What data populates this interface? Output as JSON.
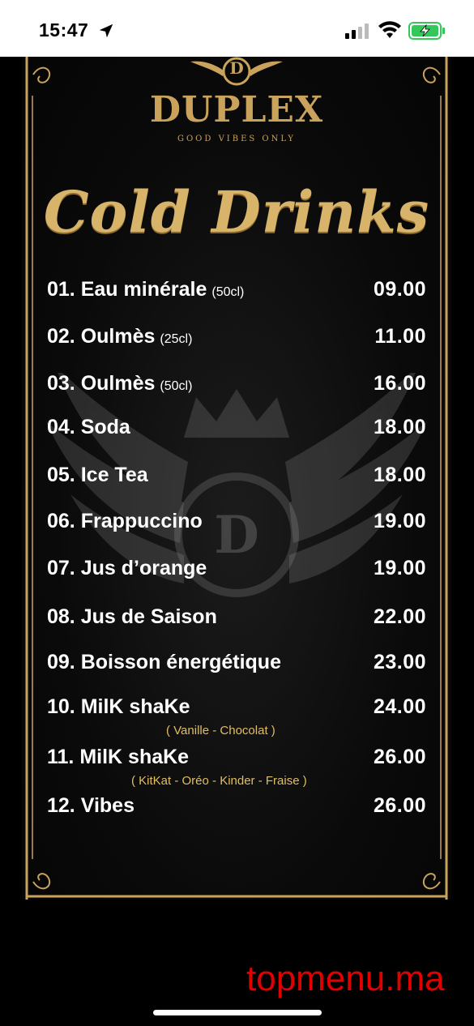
{
  "status_bar": {
    "time": "15:47",
    "icons": [
      "location-arrow-icon",
      "cellular-signal-icon",
      "wifi-icon",
      "battery-charging-icon"
    ],
    "battery_color": "#34c759"
  },
  "menu": {
    "brand": "DUPLEX",
    "brand_monogram": "D",
    "tagline": "GOOD  VIBES ONLY",
    "title": "Cold Drinks",
    "accent_color": "#c9a35b",
    "items": [
      {
        "number": "01.",
        "name": "Eau minérale",
        "size": "(50cl)",
        "price": "09.00",
        "note": ""
      },
      {
        "number": "02.",
        "name": "Oulmès",
        "size": "(25cl)",
        "price": "11.00",
        "note": ""
      },
      {
        "number": "03.",
        "name": "Oulmès",
        "size": "(50cl)",
        "price": "16.00",
        "note": ""
      },
      {
        "number": "04.",
        "name": "Soda",
        "size": "",
        "price": "18.00",
        "note": ""
      },
      {
        "number": "05.",
        "name": "Ice Tea",
        "size": "",
        "price": "18.00",
        "note": ""
      },
      {
        "number": "06.",
        "name": "Frappuccino",
        "size": "",
        "price": "19.00",
        "note": ""
      },
      {
        "number": "07.",
        "name": "Jus d’orange",
        "size": "",
        "price": "19.00",
        "note": ""
      },
      {
        "number": "08.",
        "name": "Jus de Saison",
        "size": "",
        "price": "22.00",
        "note": ""
      },
      {
        "number": "09.",
        "name": "Boisson énergétique",
        "size": "",
        "price": "23.00",
        "note": ""
      },
      {
        "number": "10.",
        "name": "MilK shaKe",
        "size": "",
        "price": "24.00",
        "note": "( Vanille - Chocolat )"
      },
      {
        "number": "11.",
        "name": "MilK shaKe",
        "size": "",
        "price": "26.00",
        "note": "( KitKat - Oréo - Kinder - Fraise )"
      },
      {
        "number": "12.",
        "name": "Vibes",
        "size": "",
        "price": "26.00",
        "note": ""
      }
    ]
  },
  "footer": {
    "site": "topmenu.ma",
    "site_color": "#e10000"
  }
}
